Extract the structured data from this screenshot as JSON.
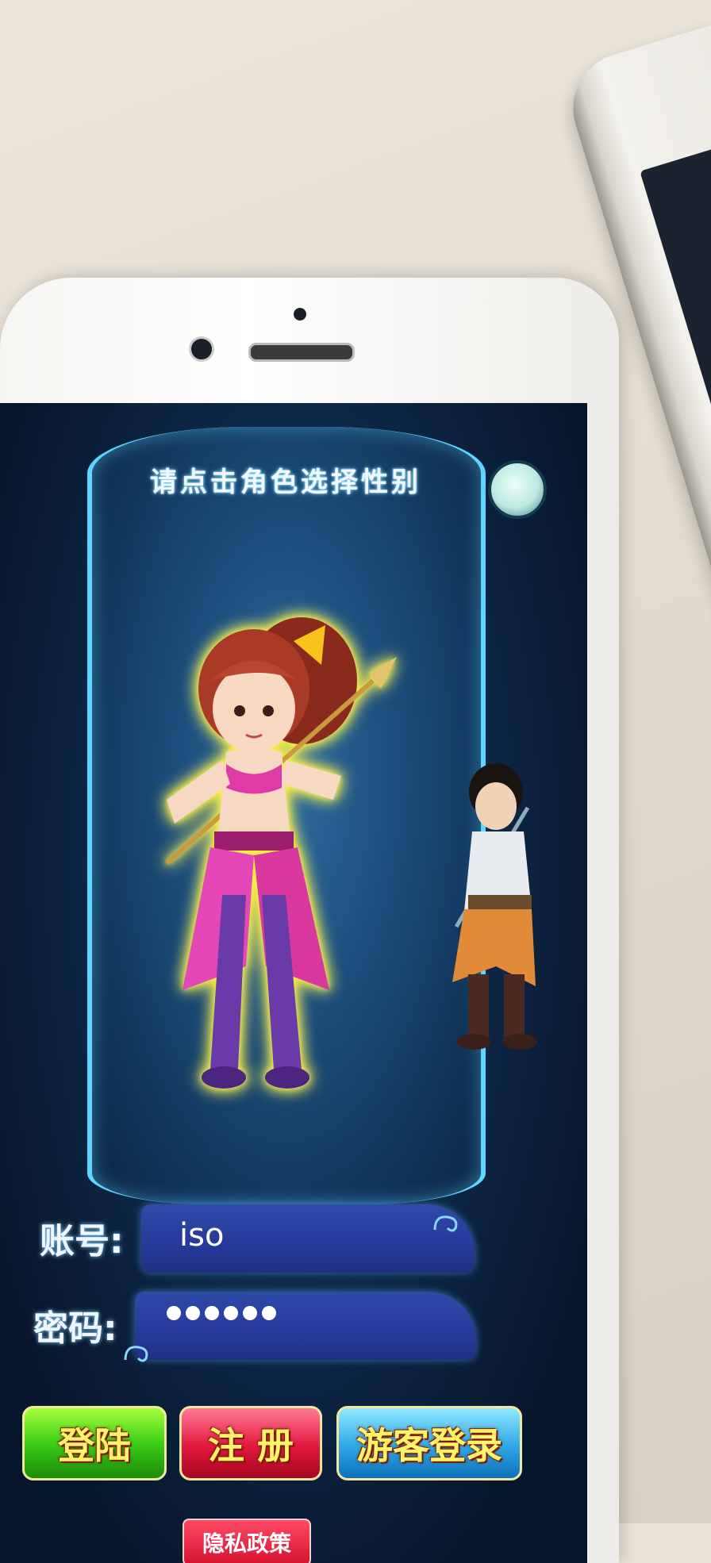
{
  "game": {
    "title": "请点击角色选择性别",
    "icons": {
      "settings": "circle-toggle-icon",
      "swirl": "cloud-swirl-icon"
    },
    "characters": [
      "female-character",
      "male-character"
    ]
  },
  "form": {
    "account_label": "账号:",
    "account_value": "iso",
    "password_label": "密码:",
    "password_dots": "●●●●●●"
  },
  "buttons": {
    "login": "登陆",
    "register": "注 册",
    "guest_login": "游客登录",
    "privacy": "隐私政策"
  },
  "colors": {
    "accent_glow": "#5fd6ff",
    "login_green": "#3bcf17",
    "register_red": "#e3173d",
    "guest_blue": "#2ea7e6",
    "privacy_red": "#d5132f"
  }
}
